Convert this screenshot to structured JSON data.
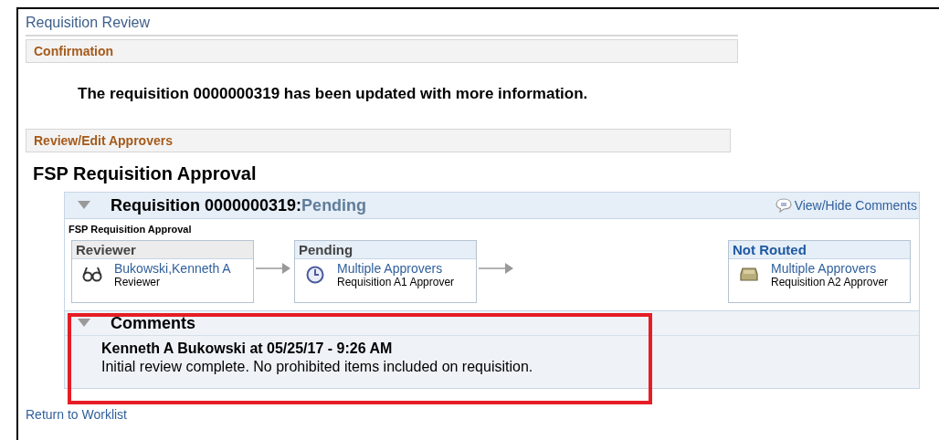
{
  "page_title": "Requisition Review",
  "confirmation": {
    "heading": "Confirmation",
    "message": "The requisition 0000000319 has been updated with more information."
  },
  "approvers_section": {
    "heading": "Review/Edit Approvers"
  },
  "approval_title": "FSP Requisition Approval",
  "requisition": {
    "title": "Requisition 0000000319:",
    "status": "Pending",
    "expanded": true,
    "comments_link": "View/Hide Comments",
    "process_label": "FSP Requisition Approval",
    "stages": [
      {
        "kind": "reviewer",
        "status": "Reviewer",
        "name": "Bukowski,Kenneth A",
        "role": "Reviewer"
      },
      {
        "kind": "pending",
        "status": "Pending",
        "name": "Multiple Approvers",
        "role": "Requisition A1 Approver"
      },
      {
        "kind": "not_routed",
        "status": "Not Routed",
        "name": "Multiple Approvers",
        "role": "Requisition A2 Approver"
      }
    ],
    "comments": {
      "heading": "Comments",
      "expanded": true,
      "highlighted": true,
      "author_line": "Kenneth A Bukowski at 05/25/17 - 9:26 AM",
      "text": "Initial review complete. No prohibited items included on requisition."
    }
  },
  "return_link": "Return to Worklist"
}
